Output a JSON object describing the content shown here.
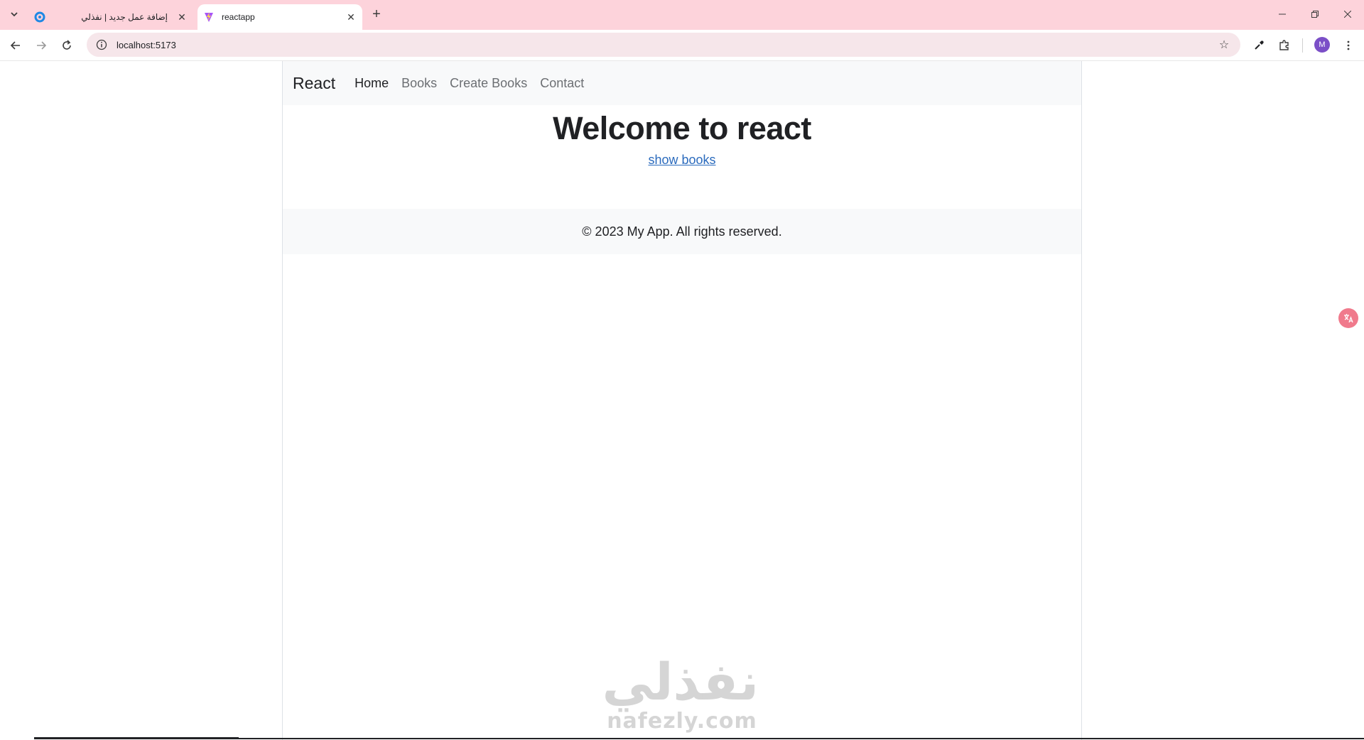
{
  "browser": {
    "tabs": [
      {
        "title": "إضافة عمل جديد | نفذلي",
        "active": false
      },
      {
        "title": "reactapp",
        "active": true
      }
    ],
    "address": "localhost:5173",
    "profile_initial": "M"
  },
  "app": {
    "brand": "React",
    "nav": [
      {
        "label": "Home",
        "active": true
      },
      {
        "label": "Books",
        "active": false
      },
      {
        "label": "Create Books",
        "active": false
      },
      {
        "label": "Contact",
        "active": false
      }
    ],
    "heading": "Welcome to react",
    "link": "show books",
    "footer": "© 2023 My App. All rights reserved."
  },
  "watermark": {
    "arabic": "نفذلي",
    "latin": "nafezly.com"
  },
  "colors": {
    "tabstrip": "#fdd3db",
    "link": "#2b6bbd",
    "navbar_bg": "#f8f9fa",
    "avatar": "#7b4fc7"
  }
}
